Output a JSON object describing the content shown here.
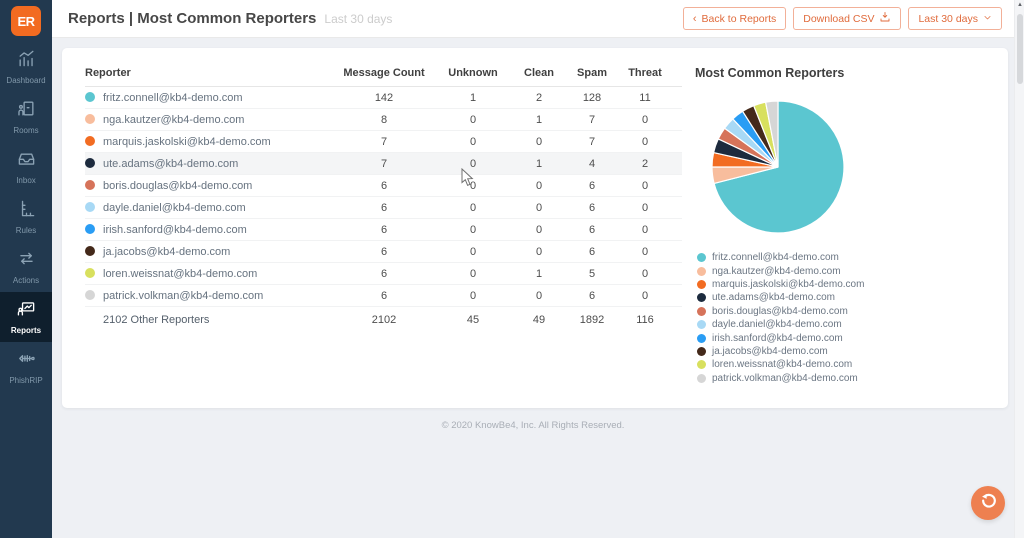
{
  "app": {
    "logo": "ER"
  },
  "sidebar": {
    "items": [
      {
        "label": "Dashboard",
        "active": false
      },
      {
        "label": "Rooms",
        "active": false
      },
      {
        "label": "Inbox",
        "active": false
      },
      {
        "label": "Rules",
        "active": false
      },
      {
        "label": "Actions",
        "active": false
      },
      {
        "label": "Reports",
        "active": true
      },
      {
        "label": "PhishRIP",
        "active": false
      }
    ]
  },
  "header": {
    "title": "Reports | Most Common Reporters",
    "subtitle": "Last 30 days",
    "back_chevron": "‹",
    "back_label": "Back to Reports",
    "download_label": "Download CSV",
    "range_label": "Last 30 days"
  },
  "table": {
    "columns": [
      "Reporter",
      "Message Count",
      "Unknown",
      "Clean",
      "Spam",
      "Threat"
    ],
    "rows": [
      {
        "reporter": "fritz.connell@kb4-demo.com",
        "color": "#5bc6d0",
        "values": [
          142,
          1,
          2,
          128,
          11
        ],
        "highlighted": false
      },
      {
        "reporter": "nga.kautzer@kb4-demo.com",
        "color": "#f8bd9d",
        "values": [
          8,
          0,
          1,
          7,
          0
        ],
        "highlighted": false
      },
      {
        "reporter": "marquis.jaskolski@kb4-demo.com",
        "color": "#f26c22",
        "values": [
          7,
          0,
          0,
          7,
          0
        ],
        "highlighted": false
      },
      {
        "reporter": "ute.adams@kb4-demo.com",
        "color": "#1d2b3e",
        "values": [
          7,
          0,
          1,
          4,
          2
        ],
        "highlighted": true
      },
      {
        "reporter": "boris.douglas@kb4-demo.com",
        "color": "#d6735a",
        "values": [
          6,
          0,
          0,
          6,
          0
        ],
        "highlighted": false
      },
      {
        "reporter": "dayle.daniel@kb4-demo.com",
        "color": "#a8d9f5",
        "values": [
          6,
          0,
          0,
          6,
          0
        ],
        "highlighted": false
      },
      {
        "reporter": "irish.sanford@kb4-demo.com",
        "color": "#2a9df4",
        "values": [
          6,
          0,
          0,
          6,
          0
        ],
        "highlighted": false
      },
      {
        "reporter": "ja.jacobs@kb4-demo.com",
        "color": "#44291a",
        "values": [
          6,
          0,
          0,
          6,
          0
        ],
        "highlighted": false
      },
      {
        "reporter": "loren.weissnat@kb4-demo.com",
        "color": "#d8e05e",
        "values": [
          6,
          0,
          1,
          5,
          0
        ],
        "highlighted": false
      },
      {
        "reporter": "patrick.volkman@kb4-demo.com",
        "color": "#d6d6d6",
        "values": [
          6,
          0,
          0,
          6,
          0
        ],
        "highlighted": false
      }
    ],
    "totals": {
      "reporter": "2102 Other Reporters",
      "values": [
        2102,
        45,
        49,
        1892,
        116
      ]
    }
  },
  "chart_data": {
    "type": "pie",
    "title": "Most Common Reporters",
    "labels": [
      "fritz.connell@kb4-demo.com",
      "nga.kautzer@kb4-demo.com",
      "marquis.jaskolski@kb4-demo.com",
      "ute.adams@kb4-demo.com",
      "boris.douglas@kb4-demo.com",
      "dayle.daniel@kb4-demo.com",
      "irish.sanford@kb4-demo.com",
      "ja.jacobs@kb4-demo.com",
      "loren.weissnat@kb4-demo.com",
      "patrick.volkman@kb4-demo.com"
    ],
    "values": [
      142,
      8,
      7,
      7,
      6,
      6,
      6,
      6,
      6,
      6
    ],
    "colors": [
      "#5bc6d0",
      "#f8bd9d",
      "#f26c22",
      "#1d2b3e",
      "#d6735a",
      "#a8d9f5",
      "#2a9df4",
      "#44291a",
      "#d8e05e",
      "#d6d6d6"
    ],
    "legend_position": "bottom-left",
    "start_angle_deg": 0,
    "direction": "clockwise"
  },
  "footer": {
    "copyright": "© 2020 KnowBe4, Inc. All Rights Reserved."
  }
}
